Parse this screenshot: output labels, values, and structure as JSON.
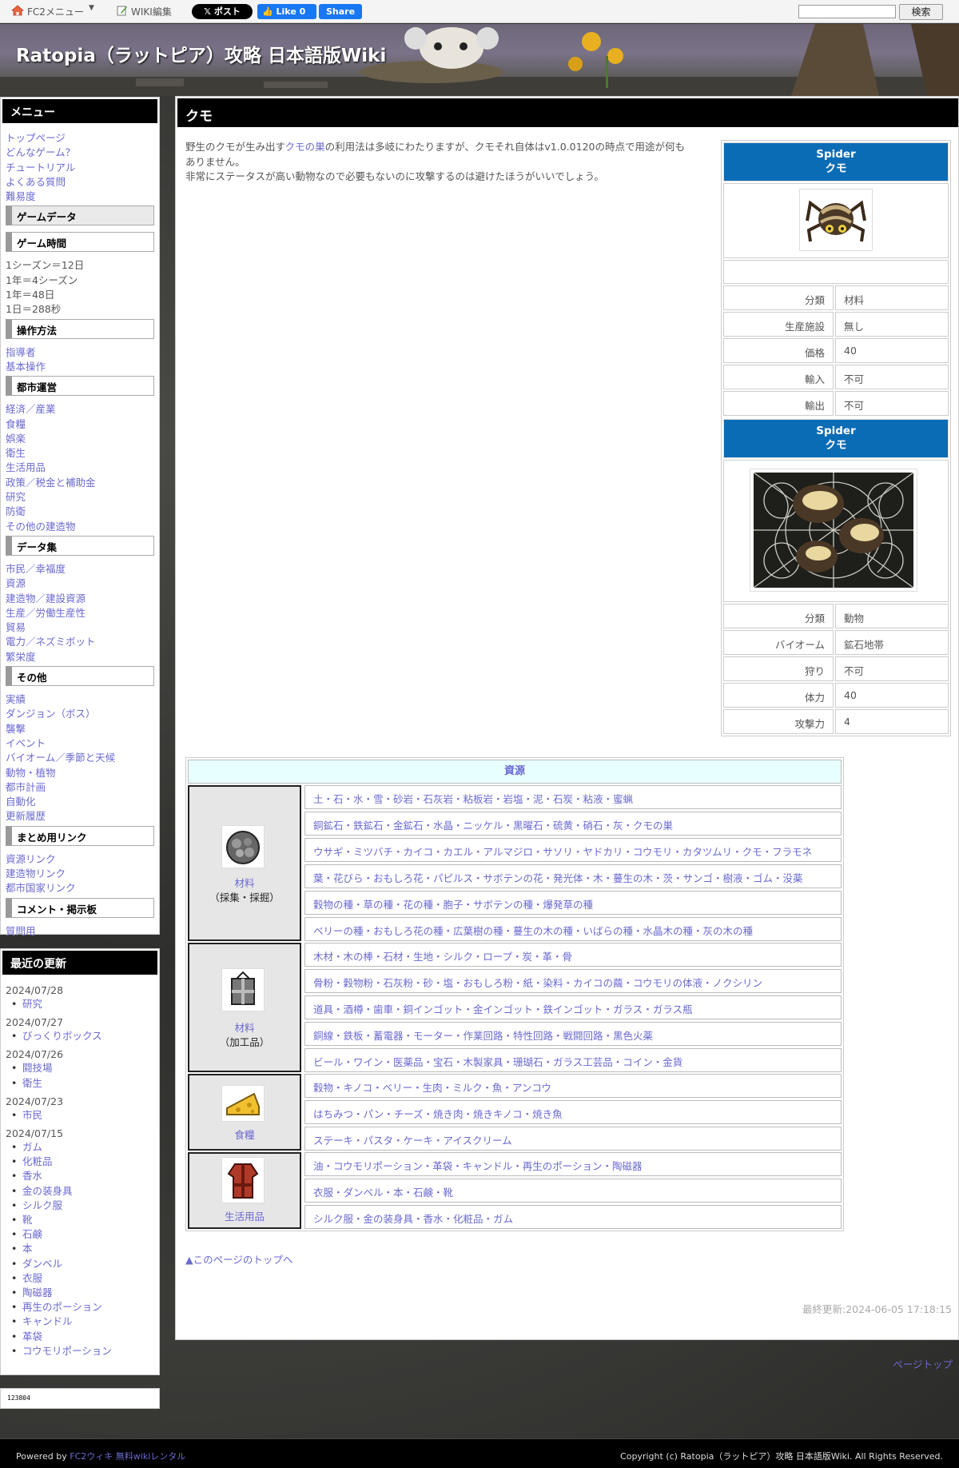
{
  "topbar": {
    "fc2_menu": "FC2メニュー",
    "wiki_edit": "WIKI編集",
    "x_post": "ポスト",
    "fb_like": "Like 0",
    "fb_share": "Share",
    "search_button": "検索",
    "search_value": ""
  },
  "header": {
    "title": "Ratopia（ラットピア）攻略 日本語版Wiki"
  },
  "menu": {
    "title": "メニュー",
    "top_links": [
      "トップページ",
      "どんなゲーム？",
      "チュートリアル",
      "よくある質問",
      "難易度"
    ],
    "game_data": "ゲームデータ",
    "game_time": "ゲーム時間",
    "time_lines": [
      "1シーズン＝12日",
      "1年＝4シーズン",
      "1年＝48日",
      "1日＝288秒"
    ],
    "controls": "操作方法",
    "controls_links": [
      "指導者",
      "基本操作"
    ],
    "city": "都市運営",
    "city_links": [
      "経済／産業",
      "食糧",
      "娯楽",
      "衛生",
      "生活用品",
      "政策／税金と補助金",
      "研究",
      "防衛",
      "その他の建造物"
    ],
    "data": "データ集",
    "data_links": [
      "市民／幸福度",
      "資源",
      "建造物／建設資源",
      "生産／労働生産性",
      "貿易",
      "電力／ネズミボット",
      "繁栄度"
    ],
    "other": "その他",
    "other_links": [
      "実績",
      "ダンジョン（ボス）",
      "襲撃",
      "イベント",
      "バイオーム／季節と天候",
      "動物・植物",
      "都市計画",
      "自動化",
      "更新履歴"
    ],
    "summary": "まとめ用リンク",
    "summary_links": [
      "資源リンク",
      "建造物リンク",
      "都市国家リンク"
    ],
    "comment": "コメント・掲示板",
    "comment_links": [
      "質問用"
    ]
  },
  "recent": {
    "title": "最近の更新",
    "groups": [
      {
        "date": "2024/07/28",
        "items": [
          "研究"
        ]
      },
      {
        "date": "2024/07/27",
        "items": [
          "びっくりボックス"
        ]
      },
      {
        "date": "2024/07/26",
        "items": [
          "闘技場",
          "衛生"
        ]
      },
      {
        "date": "2024/07/23",
        "items": [
          "市民"
        ]
      },
      {
        "date": "2024/07/15",
        "items": [
          "ガム",
          "化粧品",
          "香水",
          "金の装身具",
          "シルク服",
          "靴",
          "石鹸",
          "本",
          "ダンベル",
          "衣服",
          "陶磁器",
          "再生のポーション",
          "キャンドル",
          "革袋",
          "コウモリポーション"
        ]
      }
    ]
  },
  "counter": "123804",
  "main": {
    "title": "クモ",
    "intro_line1_pre": "野生のクモが生み出す",
    "intro_link": "クモの巣",
    "intro_line1_post": "の利用法は多岐にわたりますが、クモそれ自体はv1.0.0120の時点で用途が何もありません。",
    "intro_line2": "非常にステータスが高い動物なので必要もないのに攻撃するのは避けたほうがいいでしょう。",
    "infobox1": {
      "name_en": "Spider",
      "name_ja": "クモ",
      "rows": [
        {
          "key": "分類",
          "value": "材料",
          "link": true
        },
        {
          "key": "生産施設",
          "value": "無し"
        },
        {
          "key": "価格",
          "value": "40"
        },
        {
          "key": "輸入",
          "value": "不可"
        },
        {
          "key": "輸出",
          "value": "不可"
        }
      ]
    },
    "infobox2": {
      "name_en": "Spider",
      "name_ja": "クモ",
      "rows": [
        {
          "key": "分類",
          "value": "動物"
        },
        {
          "key": "バイオーム",
          "value": "鉱石地帯"
        },
        {
          "key": "狩り",
          "value": "不可"
        },
        {
          "key": "体力",
          "value": "40"
        },
        {
          "key": "攻撃力",
          "value": "4"
        }
      ]
    },
    "resources": {
      "title": "資源",
      "groups": [
        {
          "name": "材料",
          "sub": "（採集・採掘）",
          "icon": "ore-icon",
          "rows": [
            "土・石・水・雪・砂岩・石灰岩・粘板岩・岩塩・泥・石炭・粘液・蜜蝋",
            "銅鉱石・鉄鉱石・金鉱石・水晶・ニッケル・黒曜石・硫黄・硝石・灰・クモの巣",
            "ウサギ・ミツバチ・カイコ・カエル・アルマジロ・サソリ・ヤドカリ・コウモリ・カタツムリ・クモ・フラモネ",
            "葉・花びら・おもしろ花・パピルス・サボテンの花・発光体・木・蔓生の木・茨・サンゴ・樹液・ゴム・没薬",
            "穀物の種・草の種・花の種・胞子・サボテンの種・爆発草の種",
            "ベリーの種・おもしろ花の種・広葉樹の種・蔓生の木の種・いばらの種・水晶木の種・灰の木の種"
          ]
        },
        {
          "name": "材料",
          "sub": "（加工品）",
          "icon": "crate-icon",
          "rows": [
            "木材・木の棒・石材・生地・シルク・ロープ・炭・革・骨",
            "骨粉・穀物粉・石灰粉・砂・塩・おもしろ粉・紙・染料・カイコの繭・コウモリの体液・ノクシリン",
            "道具・酒樽・歯車・銅インゴット・金インゴット・鉄インゴット・ガラス・ガラス瓶",
            "銅線・鉄板・蓄電器・モーター・作業回路・特性回路・戦闘回路・黒色火薬",
            "ビール・ワイン・医薬品・宝石・木製家具・珊瑚石・ガラス工芸品・コイン・金貨"
          ]
        },
        {
          "name": "食糧",
          "sub": "",
          "icon": "cheese-icon",
          "rows": [
            "穀物・キノコ・ベリー・生肉・ミルク・魚・アンコウ",
            "はちみつ・パン・チーズ・焼き肉・焼きキノコ・焼き魚",
            "ステーキ・パスタ・ケーキ・アイスクリーム"
          ]
        },
        {
          "name": "生活用品",
          "sub": "",
          "icon": "clothes-icon",
          "rows": [
            "油・コウモリポーション・革袋・キャンドル・再生のポーション・陶磁器",
            "衣服・ダンベル・本・石鹸・靴",
            "シルク服・金の装身具・香水・化粧品・ガム"
          ]
        }
      ]
    },
    "to_top": "▲このページのトップへ",
    "last_updated": "最終更新:2024-06-05 17:18:15"
  },
  "page_top": "ページトップ",
  "footer": {
    "powered_pre": "Powered by ",
    "powered_link": "FC2ウィキ 無料wikiレンタル",
    "copyright": "Copyright (c) Ratopia（ラットピア）攻略 日本語版Wiki. All Rights Reserved."
  },
  "colors": {
    "infobox_header": "#0b6cb6",
    "link": "#6a6ad0",
    "resource_header_bg": "#e8ffff"
  }
}
